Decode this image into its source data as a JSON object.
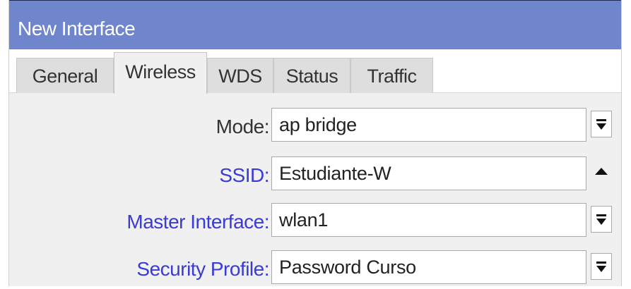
{
  "window": {
    "title": "New Interface"
  },
  "tabs": [
    {
      "label": "General",
      "active": false
    },
    {
      "label": "Wireless",
      "active": true
    },
    {
      "label": "WDS",
      "active": false
    },
    {
      "label": "Status",
      "active": false
    },
    {
      "label": "Traffic",
      "active": false
    }
  ],
  "fields": {
    "mode": {
      "label": "Mode:",
      "value": "ap bridge",
      "control_icon": "dropdown-arrow-icon"
    },
    "ssid": {
      "label": "SSID:",
      "value": "Estudiante-W",
      "control_icon": "collapse-up-icon"
    },
    "master_interface": {
      "label": "Master Interface:",
      "value": "wlan1",
      "control_icon": "dropdown-arrow-icon"
    },
    "security_profile": {
      "label": "Security Profile:",
      "value": "Password Curso",
      "control_icon": "dropdown-arrow-icon"
    }
  },
  "colors": {
    "titlebar": "#6f86cc",
    "blue_label": "#3a3ad4",
    "background": "#f0f0f0"
  }
}
